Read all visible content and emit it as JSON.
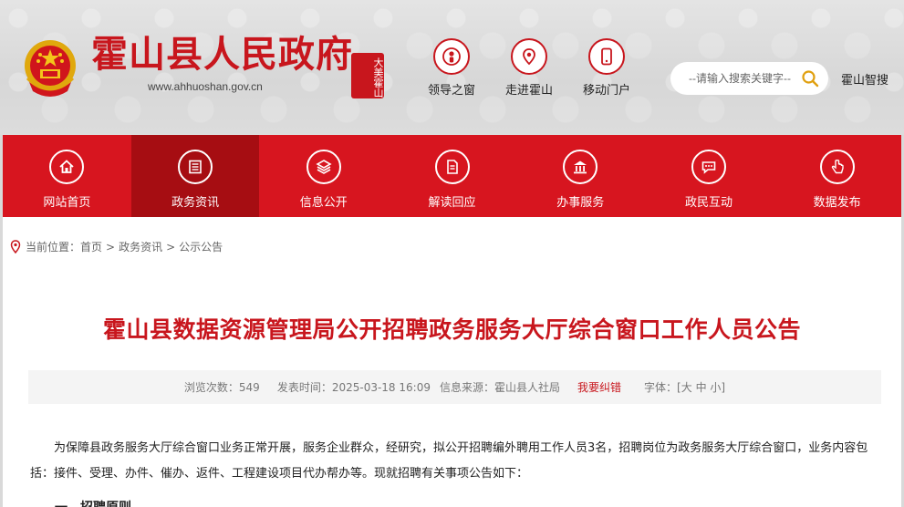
{
  "header": {
    "site_title": "霍山县人民政府",
    "site_url": "www.ahhuoshan.gov.cn",
    "seal_text": "大美霍山",
    "quick_links": [
      {
        "label": "领导之窗",
        "icon": "person-icon"
      },
      {
        "label": "走进霍山",
        "icon": "location-pin-icon"
      },
      {
        "label": "移动门户",
        "icon": "mobile-phone-icon"
      }
    ],
    "search": {
      "placeholder": "--请输入搜索关键字--",
      "value": ""
    },
    "smart_search_label": "霍山智搜"
  },
  "nav": {
    "items": [
      {
        "label": "网站首页",
        "icon": "home-icon",
        "active": false
      },
      {
        "label": "政务资讯",
        "icon": "news-icon",
        "active": true
      },
      {
        "label": "信息公开",
        "icon": "layers-icon",
        "active": false
      },
      {
        "label": "解读回应",
        "icon": "document-icon",
        "active": false
      },
      {
        "label": "办事服务",
        "icon": "building-icon",
        "active": false
      },
      {
        "label": "政民互动",
        "icon": "chat-icon",
        "active": false
      },
      {
        "label": "数据发布",
        "icon": "hand-pointer-icon",
        "active": false
      }
    ]
  },
  "breadcrumb": {
    "prefix": "当前位置：",
    "items": [
      "首页",
      "政务资讯",
      "公示公告"
    ],
    "separator": ">"
  },
  "article": {
    "title": "霍山县数据资源管理局公开招聘政务服务大厅综合窗口工作人员公告",
    "meta": {
      "views_label": "浏览次数：",
      "views": "549",
      "published_label": "发表时间：",
      "published": "2025-03-18 16:09",
      "source_label": "信息来源：",
      "source": "霍山县人社局",
      "report_label": "我要纠错",
      "font_label": "字体：",
      "font_sizes": [
        "大",
        "中",
        "小"
      ]
    },
    "paragraph": "为保障县政务服务大厅综合窗口业务正常开展，服务企业群众，经研究，拟公开招聘编外聘用工作人员3名，招聘岗位为政务服务大厅综合窗口，业务内容包括：接件、受理、办件、催办、返件、工程建设项目代办帮办等。现就招聘有关事项公告如下：",
    "next_heading": "一、招聘原则"
  },
  "colors": {
    "brand_red": "#d7151f",
    "nav_active": "#a60d12",
    "title_red": "#c8161d"
  }
}
